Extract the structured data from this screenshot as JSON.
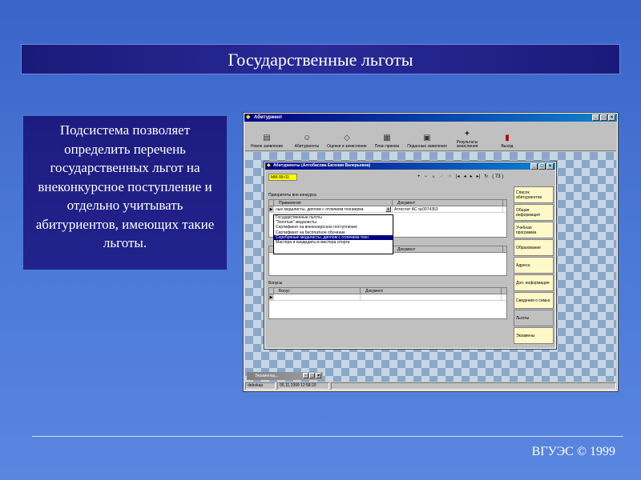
{
  "slide": {
    "title": "Государственные льготы",
    "description": "Подсистема позволяет определить перечень государственных льгот на внеконкурсное поступление и отдельно учитывать абитуриентов, имеющих такие льготы.",
    "footer": "ВГУЭС © 1999"
  },
  "app": {
    "title": "Абитуриент",
    "toolbar": [
      {
        "icon": "document-icon",
        "label": "Новое заявление"
      },
      {
        "icon": "people-icon",
        "label": "Абитуриенты"
      },
      {
        "icon": "grades-icon",
        "label": "Оценки и зачисление"
      },
      {
        "icon": "plan-icon",
        "label": "План приема"
      },
      {
        "icon": "submitted-icon",
        "label": "Поданные заявления"
      },
      {
        "icon": "results-icon",
        "label": "Результаты зачисления"
      },
      {
        "icon": "exit-icon",
        "label": "Выход"
      }
    ],
    "child": {
      "title": "Абитуриенты (Алтобасова Евгения Валерьевна)",
      "code": "ММ-99-01",
      "record_count": "( 73 )",
      "priority_label": "Приоритеты вне конкурса",
      "priority_grid": {
        "headers": [
          "Привилегия",
          "Документ"
        ],
        "row": [
          "ные медалисты, диплом с отличием техникума",
          "Аттестат АС №0074353"
        ]
      },
      "dropdown_items": [
        "Государственные льготы",
        "\"Золотые\" медалисты",
        "Сертификат на внеконкурсное поступление",
        "Сертификат на бесплатное обучение",
        "Серебряные медалисты, диплом с отличием техн",
        "Мастера и кандидаты в мастера спорта"
      ],
      "dropdown_selected_index": 4,
      "second_grid_header": "Документ",
      "bonus_label": "Бонусы",
      "bonus_grid": {
        "headers": [
          "Бонус",
          "Документ"
        ]
      },
      "side_tabs": [
        "Список абитуриентов",
        "Общая информация",
        "Учебная программа",
        "Образование",
        "Адреса",
        "Доп. информация",
        "Сведения о семье",
        "Льготы",
        "Экзамены"
      ],
      "active_tab_index": 7
    },
    "minimized_window": "Экзаменац...",
    "status": {
      "user": "debokaa",
      "datetime": "05.11.1999 12:58:20"
    }
  }
}
